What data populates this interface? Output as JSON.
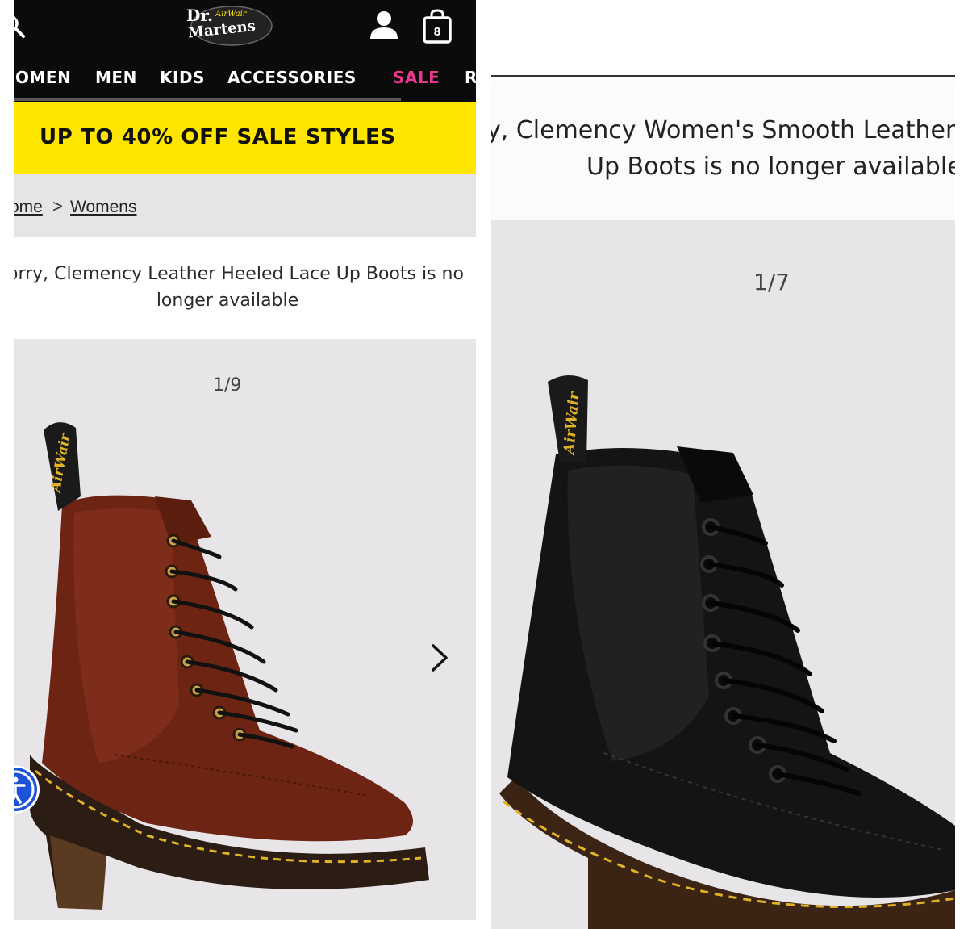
{
  "left": {
    "nav": {
      "items": [
        "OMEN",
        "MEN",
        "KIDS",
        "ACCESSORIES",
        "SALE",
        "R"
      ],
      "sale_color": "#e8398e"
    },
    "logo": {
      "line1": "Dr.",
      "line2": "Martens",
      "air_wair": "AirWair"
    },
    "icons": [
      "search-icon",
      "account-icon",
      "shopping-bag-icon"
    ],
    "bag_count": "8",
    "promo": {
      "text": "UP TO 40% OFF SALE STYLES",
      "background": "#ffe500"
    },
    "breadcrumb": {
      "home": "ome",
      "separator": ">",
      "current": "Womens"
    },
    "message": {
      "line1": "orry, Clemency Leather Heeled Lace Up Boots is no",
      "line2": "longer available"
    },
    "gallery": {
      "counter": "1/9",
      "next_icon": "chevron-right-icon",
      "boot_color": "#6e2412",
      "pull_tab": "AirWair"
    }
  },
  "right": {
    "message": {
      "line1": "y, Clemency Women's Smooth Leather",
      "line2": "Up Boots is no longer available"
    },
    "gallery": {
      "counter": "1/7",
      "boot_color": "#141414",
      "pull_tab": "AirWair"
    }
  }
}
